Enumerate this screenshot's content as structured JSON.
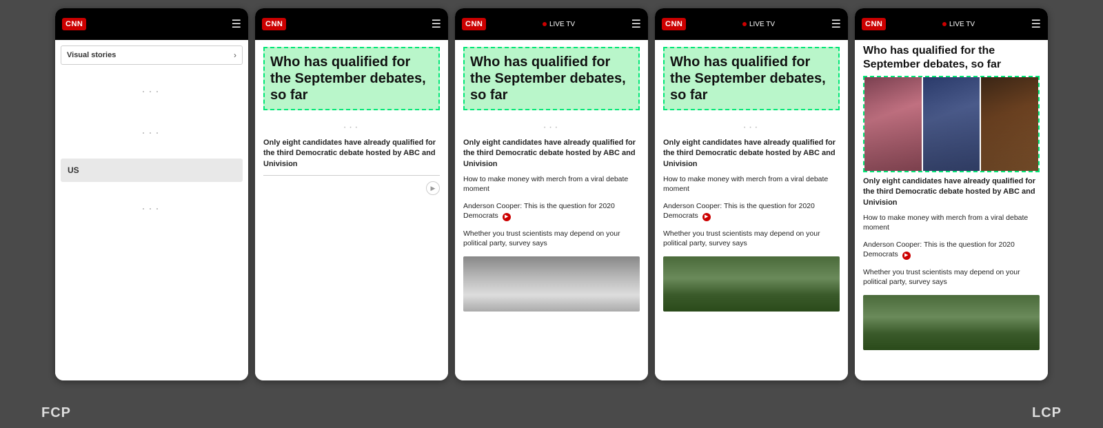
{
  "background": "#4a4a4a",
  "phones": [
    {
      "id": "phone1",
      "type": "visual-stories",
      "header": {
        "logo": "CNN",
        "show_live_tv": false
      },
      "visual_stories_label": "Visual stories",
      "us_label": "US",
      "footer_label": "FCP"
    },
    {
      "id": "phone2",
      "type": "article",
      "header": {
        "logo": "CNN",
        "show_live_tv": false
      },
      "headline": "Who has qualified for the September debates, so far",
      "body_text": "Only eight candidates have already qualified for the third Democratic debate hosted by ABC and Univision",
      "footer_label": ""
    },
    {
      "id": "phone3",
      "type": "article-with-items",
      "header": {
        "logo": "CNN",
        "show_live_tv": true,
        "live_tv_text": "LIVE TV"
      },
      "headline": "Who has qualified for the September debates, so far",
      "body_text": "Only eight candidates have already qualified for the third Democratic debate hosted by ABC and Univision",
      "sub_items": [
        "How to make money with merch from a viral debate moment",
        "Anderson Cooper: This is the question for 2020 Democrats",
        "Whether you trust scientists may depend on your political party, survey says"
      ],
      "has_video": true,
      "footer_label": ""
    },
    {
      "id": "phone4",
      "type": "article-with-items",
      "header": {
        "logo": "CNN",
        "show_live_tv": true,
        "live_tv_text": "LIVE TV"
      },
      "headline": "Who has qualified for the September debates, so far",
      "body_text": "Only eight candidates have already qualified for the third Democratic debate hosted by ABC and Univision",
      "sub_items": [
        "How to make money with merch from a viral debate moment",
        "Anderson Cooper: This is the question for 2020 Democrats",
        "Whether you trust scientists may depend on your political party, survey says"
      ],
      "has_video": true,
      "footer_label": ""
    },
    {
      "id": "phone5",
      "type": "article-with-photo",
      "header": {
        "logo": "CNN",
        "show_live_tv": true,
        "live_tv_text": "LIVE TV"
      },
      "headline": "Who has qualified for the September debates, so far",
      "body_text": "Only eight candidates have already qualified for the third Democratic debate hosted by ABC and Univision",
      "sub_items": [
        "How to make money with merch from a viral debate moment",
        "Anderson Cooper: This is the question for 2020 Democrats",
        "Whether you trust scientists may depend on your political party, survey says"
      ],
      "has_video": true,
      "has_photo_strip": true,
      "footer_label": "LCP"
    }
  ],
  "labels": {
    "fcp": "FCP",
    "lcp": "LCP",
    "visual_stories": "Visual stories",
    "us": "US",
    "live_tv": "LIVE TV",
    "headline": "Who has qualified for the September debates, so far",
    "body": "Only eight candidates have already qualified for the third Democratic debate hosted by ABC and Univision",
    "sub1": "How to make money with merch from a viral debate moment",
    "sub2": "Anderson Cooper: This is the question for 2020 Democrats",
    "sub3": "Whether you trust scientists may depend on your political party, survey says",
    "dots": "···",
    "play_symbol": "▶"
  }
}
